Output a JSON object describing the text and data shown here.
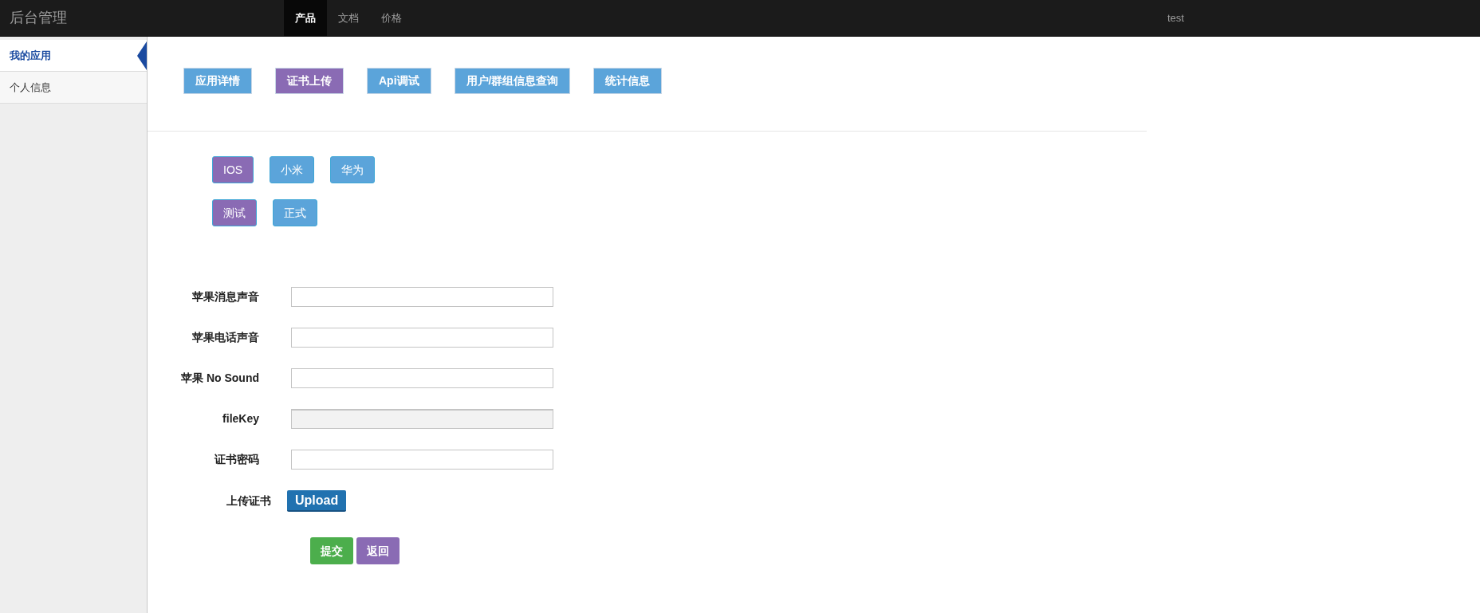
{
  "header": {
    "brand": "后台管理",
    "nav": [
      {
        "label": "产品",
        "selected": true
      },
      {
        "label": "文档",
        "selected": false
      },
      {
        "label": "价格",
        "selected": false
      }
    ],
    "user": "test"
  },
  "sidebar": {
    "items": [
      {
        "label": "我的应用",
        "selected": true
      },
      {
        "label": "个人信息",
        "selected": false
      }
    ]
  },
  "tabs": [
    {
      "label": "应用详情",
      "selected": false
    },
    {
      "label": "证书上传",
      "selected": true
    },
    {
      "label": "Api调试",
      "selected": false
    },
    {
      "label": "用户/群组信息查询",
      "selected": false
    },
    {
      "label": "统计信息",
      "selected": false
    }
  ],
  "platforms": [
    {
      "label": "IOS",
      "selected": true
    },
    {
      "label": "小米",
      "selected": false
    },
    {
      "label": "华为",
      "selected": false
    }
  ],
  "environments": [
    {
      "label": "测试",
      "selected": true
    },
    {
      "label": "正式",
      "selected": false
    }
  ],
  "form": {
    "fields": [
      {
        "label": "苹果消息声音",
        "disabled": false
      },
      {
        "label": "苹果电话声音",
        "disabled": false
      },
      {
        "label": "苹果 No Sound",
        "disabled": false
      },
      {
        "label": "fileKey",
        "disabled": true
      },
      {
        "label": "证书密码",
        "disabled": false
      }
    ],
    "upload": {
      "label": "上传证书",
      "button": "Upload"
    },
    "buttons": [
      {
        "label": "提交",
        "kind": "primary"
      },
      {
        "label": "返回",
        "kind": "secondary"
      }
    ]
  }
}
